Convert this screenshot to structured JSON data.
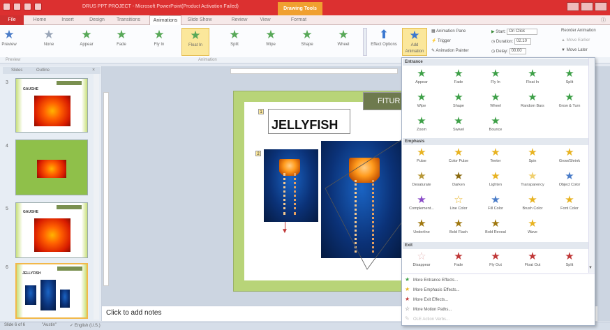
{
  "titlebar": {
    "title": "DRUS PPT PROJECT - Microsoft PowerPoint(Product Activation Failed)",
    "context_tab": "Drawing Tools"
  },
  "tabs": [
    {
      "label": "File"
    },
    {
      "label": "Home"
    },
    {
      "label": "Insert"
    },
    {
      "label": "Design"
    },
    {
      "label": "Transitions"
    },
    {
      "label": "Animations"
    },
    {
      "label": "Slide Show"
    },
    {
      "label": "Review"
    },
    {
      "label": "View"
    },
    {
      "label": "Format"
    }
  ],
  "ribbon": {
    "preview_label": "Preview",
    "animation_buttons": [
      {
        "label": "None"
      },
      {
        "label": "Appear"
      },
      {
        "label": "Fade"
      },
      {
        "label": "Fly In"
      },
      {
        "label": "Float In"
      },
      {
        "label": "Split"
      },
      {
        "label": "Wipe"
      },
      {
        "label": "Shape"
      },
      {
        "label": "Wheel"
      }
    ],
    "effect_options_label": "Effect Options",
    "add_animation_label": "Add Animation",
    "animation_pane_label": "Animation Pane",
    "trigger_label": "Trigger",
    "animation_painter_label": "Animation Painter",
    "start_label": "Start:",
    "start_value": "On Click",
    "duration_label": "Duration:",
    "duration_value": "02.10",
    "delay_label": "Delay:",
    "delay_value": "00.00",
    "reorder_label": "Reorder Animation",
    "move_earlier_label": "Move Earlier",
    "move_later_label": "Move Later",
    "group_preview": "Preview",
    "group_animation": "Animation"
  },
  "slide_panel": {
    "tab_slides": "Slides",
    "tab_outline": "Outline",
    "slides": [
      {
        "number": "3",
        "title": "GAUGHE"
      },
      {
        "number": "4",
        "title": ""
      },
      {
        "number": "5",
        "title": "GAUGHE"
      },
      {
        "number": "6",
        "title": "JELLYFISH"
      }
    ]
  },
  "slide": {
    "fitur_label": "FITUR",
    "heading": "JELLYFISH",
    "anim_tag_heading": "1",
    "anim_tag_image": "2"
  },
  "notes": {
    "placeholder": "Click to add notes"
  },
  "statusbar": {
    "slide_info": "Slide 6 of 6",
    "theme": "\"Austin\"",
    "language": "English (U.S.)"
  },
  "dropdown": {
    "entrance": {
      "header": "Entrance",
      "items": [
        "Appear",
        "Fade",
        "Fly In",
        "Float In",
        "Split",
        "Wipe",
        "Shape",
        "Wheel",
        "Random Bars",
        "Grow & Turn",
        "Zoom",
        "Swivel",
        "Bounce"
      ]
    },
    "emphasis": {
      "header": "Emphasis",
      "items": [
        "Pulse",
        "Color Pulse",
        "Teeter",
        "Spin",
        "Grow/Shrink",
        "Desaturate",
        "Darken",
        "Lighten",
        "Transparency",
        "Object Color",
        "Complement...",
        "Line Color",
        "Fill Color",
        "Brush Color",
        "Font Color",
        "Underline",
        "Bold Flash",
        "Bold Reveal",
        "Wave"
      ]
    },
    "exit": {
      "header": "Exit",
      "items": [
        "Disappear",
        "Fade",
        "Fly Out",
        "Float Out",
        "Split"
      ]
    },
    "more": [
      {
        "label": "More Entrance Effects...",
        "icon": "green-star-icon"
      },
      {
        "label": "More Emphasis Effects...",
        "icon": "yellow-star-icon"
      },
      {
        "label": "More Exit Effects...",
        "icon": "red-star-icon"
      },
      {
        "label": "More Motion Paths...",
        "icon": "outline-star-icon"
      },
      {
        "label": "OLE Action Verbs...",
        "icon": "disabled-star-icon"
      }
    ]
  },
  "colors": {
    "titlebar": "#dc3030",
    "selected_button": "#fbe79b",
    "entrance_star": "#3ea048",
    "emphasis_star": "#e8b322",
    "exit_star": "#c03838",
    "slide_border": "#b8d478"
  }
}
